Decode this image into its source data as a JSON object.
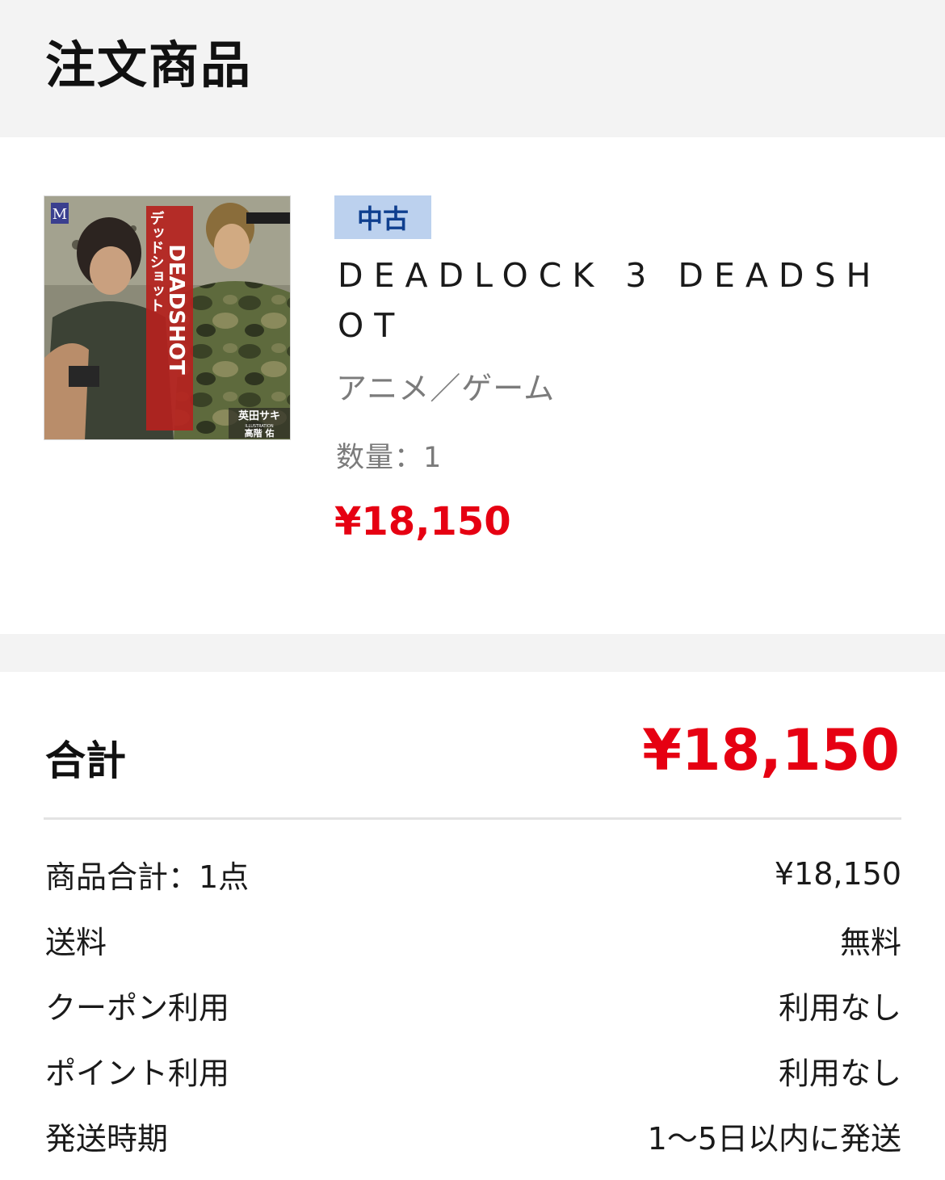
{
  "header": {
    "title": "注文商品"
  },
  "product": {
    "cover": {
      "alt_title": "デッドショット",
      "publisher_mark": "M",
      "author": "英田サキ",
      "illustration_label": "ILLUSTRATION",
      "illustrator": "高階 佑",
      "logo_text": "DEADSHOT"
    },
    "condition_badge": "中古",
    "title": "DEADLOCK 3 DEADSHOT",
    "category": "アニメ／ゲーム",
    "quantity": "数量：1",
    "price": "¥18,150"
  },
  "summary": {
    "total_label": "合計",
    "total_value": "¥18,150",
    "rows": [
      {
        "label": "商品合計：1点",
        "value": "¥18,150"
      },
      {
        "label": "送料",
        "value": "無料"
      },
      {
        "label": "クーポン利用",
        "value": "利用なし"
      },
      {
        "label": "ポイント利用",
        "value": "利用なし"
      },
      {
        "label": "発送時期",
        "value": "1〜5日以内に発送"
      }
    ]
  },
  "colors": {
    "accent_red": "#e60012",
    "badge_bg": "#bcd1ee",
    "badge_text": "#0f3f8f",
    "band_gray": "#f3f3f3"
  }
}
